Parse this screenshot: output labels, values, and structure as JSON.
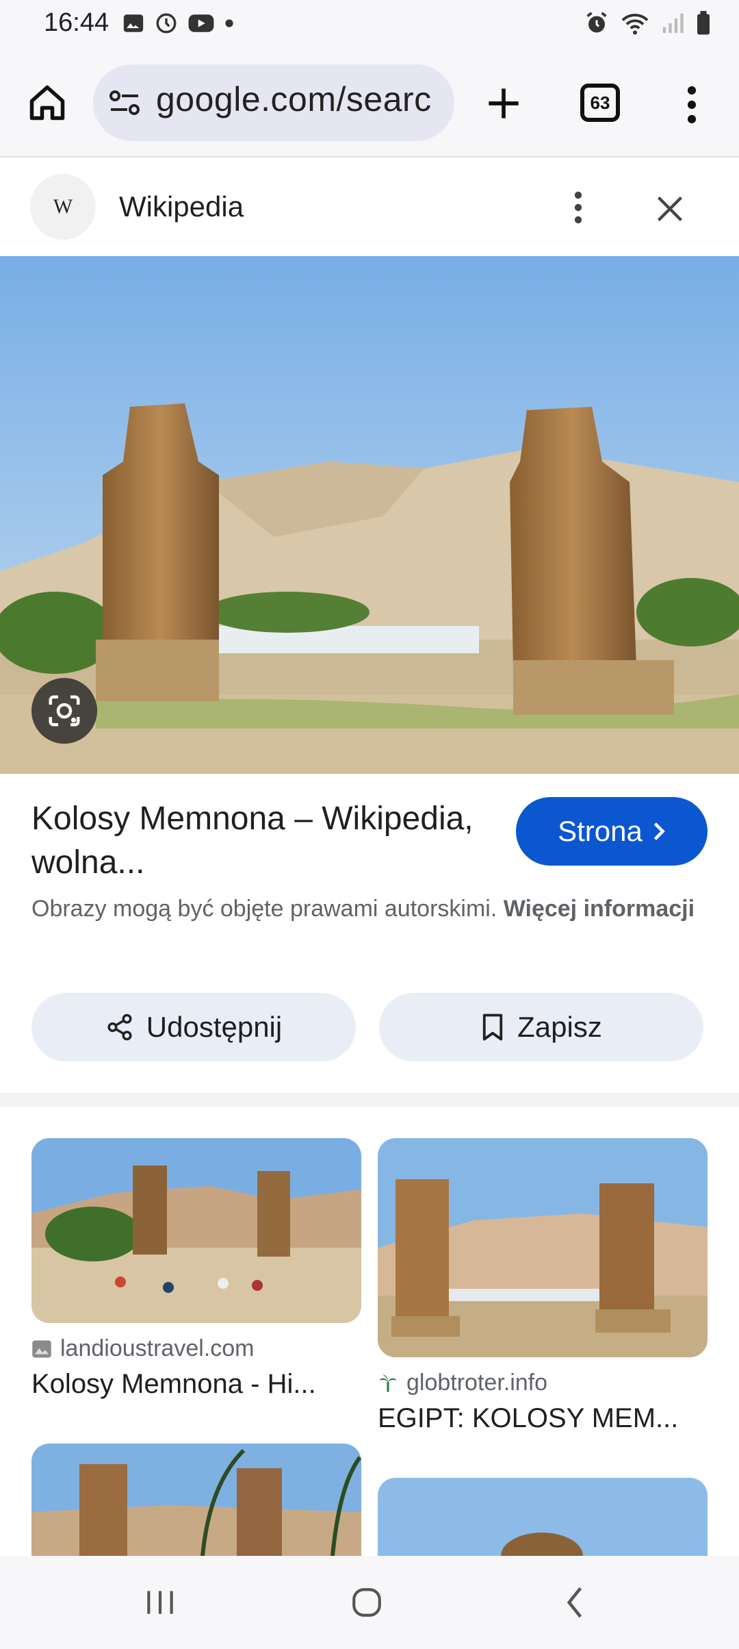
{
  "status_bar": {
    "time": "16:44",
    "left_icons": [
      "image-icon",
      "clock-icon",
      "youtube-icon",
      "dot-icon"
    ],
    "right_icons": [
      "alarm-icon",
      "wifi-icon",
      "signal-icon",
      "battery-icon"
    ]
  },
  "toolbar": {
    "url": "google.com/searc",
    "tab_count": "63"
  },
  "panel": {
    "logo_text": "W",
    "source": "Wikipedia"
  },
  "result": {
    "title": "Kolosy Memnona – Wikipedia, wolna...",
    "visit_label": "Strona",
    "copyright_text": "Obrazy mogą być objęte prawami autorskimi.",
    "more_info": "Więcej informacji",
    "share_label": "Udostępnij",
    "save_label": "Zapisz"
  },
  "related": [
    {
      "source": "landioustravel.com",
      "title": "Kolosy Memnona - Hi..."
    },
    {
      "source": "globtroter.info",
      "title": "EGIPT: KOLOSY MEM..."
    }
  ],
  "colors": {
    "accent": "#0b57d0",
    "button_bg": "#e9eef6",
    "sky": "#7fb2e6",
    "sand": "#d7c7a6"
  }
}
